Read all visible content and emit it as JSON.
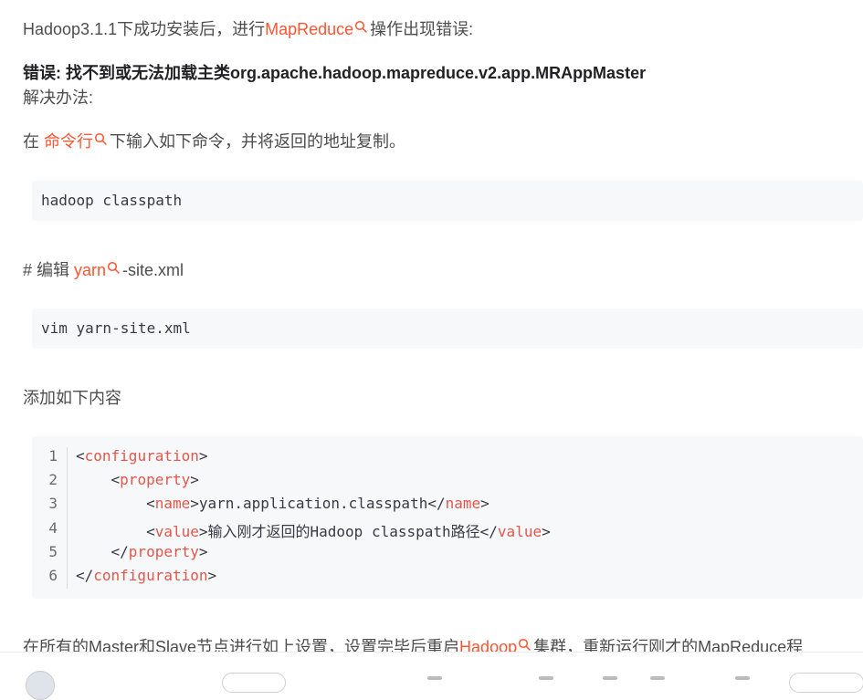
{
  "article": {
    "intro": {
      "before": "Hadoop3.1.1下成功安装后，进行",
      "link": "MapReduce",
      "after": "操作出现错误:"
    },
    "error": "错误: 找不到或无法加载主类org.apache.hadoop.mapreduce.v2.app.MRAppMaster",
    "solution_label": "解决办法:",
    "step1": {
      "before": "在",
      "link": "命令行",
      "after": "下输入如下命令，并将返回的地址复制。"
    },
    "cmd1": "hadoop classpath",
    "step2": {
      "before": "# 编辑",
      "link": "yarn",
      "after": "-site.xml"
    },
    "cmd2": "vim yarn-site.xml",
    "step3": "添加如下内容",
    "code": {
      "line_numbers": [
        "1",
        "2",
        "3",
        "4",
        "5",
        "6"
      ],
      "lines": [
        {
          "indent": "",
          "open": "<",
          "tag": "configuration",
          "close": ">",
          "text": "",
          "end_open": "",
          "end_tag": "",
          "end_close": ""
        },
        {
          "indent": "    ",
          "open": "<",
          "tag": "property",
          "close": ">",
          "text": "",
          "end_open": "",
          "end_tag": "",
          "end_close": ""
        },
        {
          "indent": "        ",
          "open": "<",
          "tag": "name",
          "close": ">",
          "text": "yarn.application.classpath",
          "end_open": "</",
          "end_tag": "name",
          "end_close": ">"
        },
        {
          "indent": "        ",
          "open": "<",
          "tag": "value",
          "close": ">",
          "text": "输入刚才返回的Hadoop classpath路径",
          "end_open": "</",
          "end_tag": "value",
          "end_close": ">"
        },
        {
          "indent": "    ",
          "open": "</",
          "tag": "property",
          "close": ">",
          "text": "",
          "end_open": "",
          "end_tag": "",
          "end_close": ""
        },
        {
          "indent": "",
          "open": "</",
          "tag": "configuration",
          "close": ">",
          "text": "",
          "end_open": "",
          "end_tag": "",
          "end_close": ""
        }
      ]
    },
    "final": {
      "before": "在所有的Master和Slave节点进行如上设置，设置完毕后重启",
      "link": "Hadoop",
      "after": "集群，重新运行刚才的MapReduce程"
    }
  },
  "colors": {
    "keyword": "#fc5531",
    "tag": "#e45649",
    "code_bg": "#f6f8fa"
  }
}
